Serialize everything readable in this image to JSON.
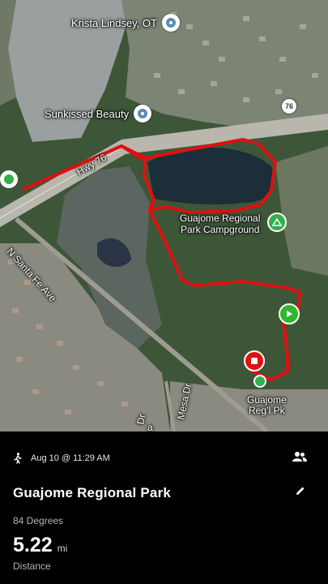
{
  "map": {
    "pois": [
      {
        "label": "Krista Lindsey, OT",
        "icon": "location-pin-icon"
      },
      {
        "label": "Sunkissed Beauty",
        "icon": "location-pin-icon"
      }
    ],
    "road_labels": {
      "hwy": "Hwy 76",
      "sfe": "N Santa Fe Ave",
      "mesa": "Mesa Dr",
      "dr": "Dr",
      "a": "a"
    },
    "route_shield": "76",
    "campground_label": "Guajome Regional\nPark Campground",
    "park_label": "Guajome\nReg’l Pk",
    "route_color": "#e01010",
    "start_color": "#2eb82e",
    "end_color": "#e01010"
  },
  "activity": {
    "type_icon": "walking-icon",
    "date_time": "Aug 10 @ 11:29 AM",
    "title": "Guajome Regional Park",
    "subtitle": "84 Degrees",
    "distance_value": "5.22",
    "distance_unit": "mi",
    "distance_label": "Distance"
  }
}
